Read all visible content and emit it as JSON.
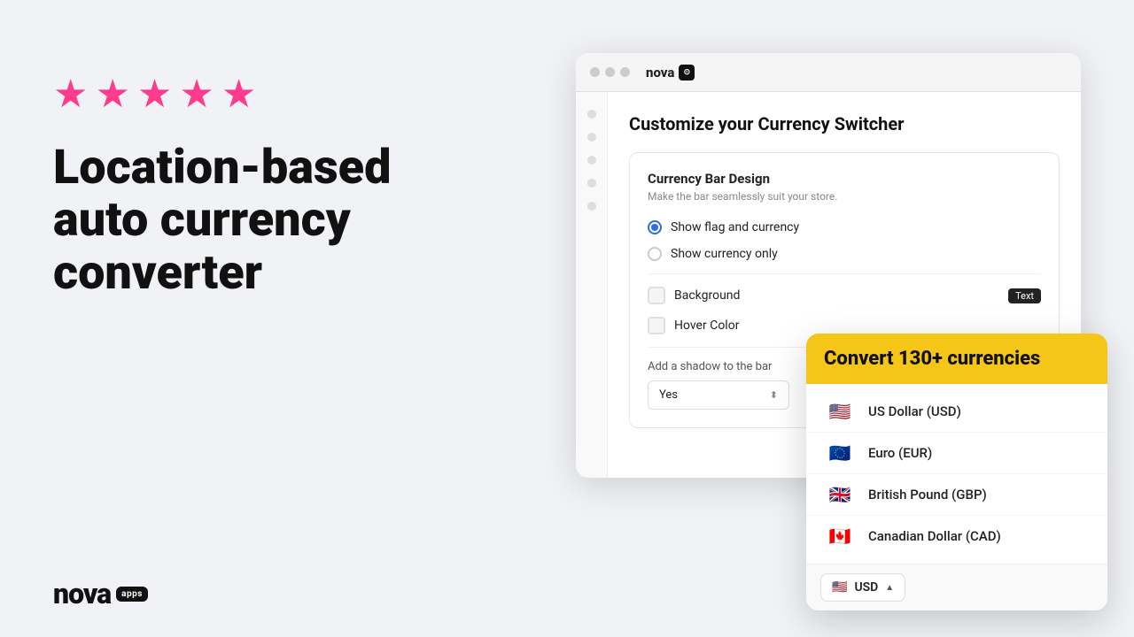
{
  "page": {
    "background": "#f0f2f5"
  },
  "left": {
    "stars": [
      "★",
      "★",
      "★",
      "★",
      "★"
    ],
    "headline_line1": "Location-based",
    "headline_line2": "auto currency",
    "headline_line3": "converter"
  },
  "nova_logo": {
    "text": "nova",
    "badge": "apps"
  },
  "browser": {
    "title_bar": {
      "nova_text": "nova",
      "nova_badge": "⊙"
    },
    "page_title": "Customize your Currency Switcher",
    "card": {
      "title": "Currency Bar Design",
      "subtitle": "Make the bar seamlessly suit your store.",
      "option1": "Show flag and currency",
      "option2": "Show currency only",
      "bg_label": "Background",
      "text_badge": "Text",
      "hover_label": "Hover Color",
      "shadow_label": "Add a shadow to the bar",
      "shadow_value": "Yes"
    }
  },
  "currency_panel": {
    "header": "Convert 130+ currencies",
    "currencies": [
      {
        "flag": "🇺🇸",
        "name": "US Dollar (USD)"
      },
      {
        "flag": "🇪🇺",
        "name": "Euro (EUR)"
      },
      {
        "flag": "🇬🇧",
        "name": "British Pound (GBP)"
      },
      {
        "flag": "🇨🇦",
        "name": "Canadian Dollar (CAD)"
      }
    ],
    "footer_flag": "🇺🇸",
    "footer_currency": "USD",
    "footer_chevron": "▲"
  }
}
